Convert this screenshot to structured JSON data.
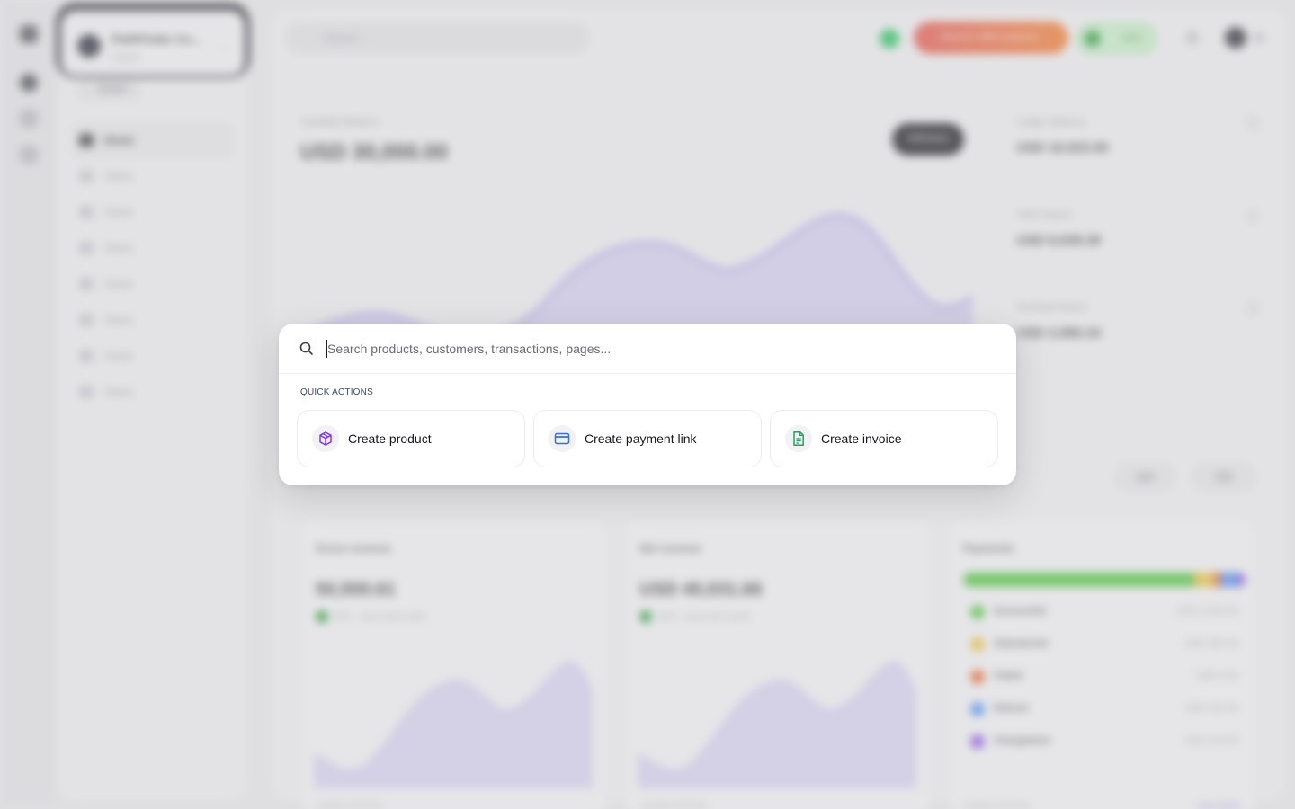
{
  "background": {
    "org": {
      "name": "PathFinder Co...",
      "subtitle": "Owner"
    },
    "sidebar_button": "Button",
    "nav_items": [
      "Home",
      "Home",
      "Home",
      "Home",
      "Home",
      "Home",
      "Home",
      "Home"
    ],
    "search_placeholder": "Search...",
    "alert_pill": "Discover offline payment",
    "status_pill": "Sales",
    "balance": {
      "label": "Available Balance",
      "value": "USD 30,000.00",
      "withdraw": "Withdraw"
    },
    "stats": [
      {
        "label": "Ledger Balance",
        "value": "USD 10,523.00"
      },
      {
        "label": "Total Payout",
        "value": "USD 6,639.39"
      },
      {
        "label": "Pending Payout",
        "value": "USD 2,966.34"
      }
    ],
    "add_label": "Add",
    "edit_label": "Edit",
    "cards": [
      {
        "title": "Gross revenue",
        "value": "50,500.61",
        "note": "15% ↑ since last month",
        "foot": "Updated 03:05 AM"
      },
      {
        "title": "Net revenue",
        "value": "USD 40,031.66",
        "note": "15% ↑ since last month",
        "foot": "Updated 03:05 AM"
      }
    ],
    "payments": {
      "title": "Payments",
      "rows": [
        {
          "name": "Successful",
          "amount": "USD 1,223.45",
          "color": "#4cc23a"
        },
        {
          "name": "Abandoned",
          "amount": "USD 300.45",
          "color": "#e8c13a"
        },
        {
          "name": "Failed",
          "amount": "USD 0.00",
          "color": "#e8622a"
        },
        {
          "name": "Refund",
          "amount": "USD 223.45",
          "color": "#4f8cf0"
        },
        {
          "name": "Chargeback",
          "amount": "USD 123.45",
          "color": "#8a4fe0"
        }
      ],
      "foot": "Updated 03:05 AM",
      "link": "View details"
    }
  },
  "palette": {
    "search_placeholder": "Search products, customers, transactions, pages...",
    "section_title": "QUICK ACTIONS",
    "actions": [
      {
        "label": "Create product",
        "icon": "cube-icon",
        "color": "#7c3aed"
      },
      {
        "label": "Create payment link",
        "icon": "credit-card-icon",
        "color": "#3b6fe0"
      },
      {
        "label": "Create invoice",
        "icon": "document-icon",
        "color": "#22a35a"
      }
    ]
  }
}
